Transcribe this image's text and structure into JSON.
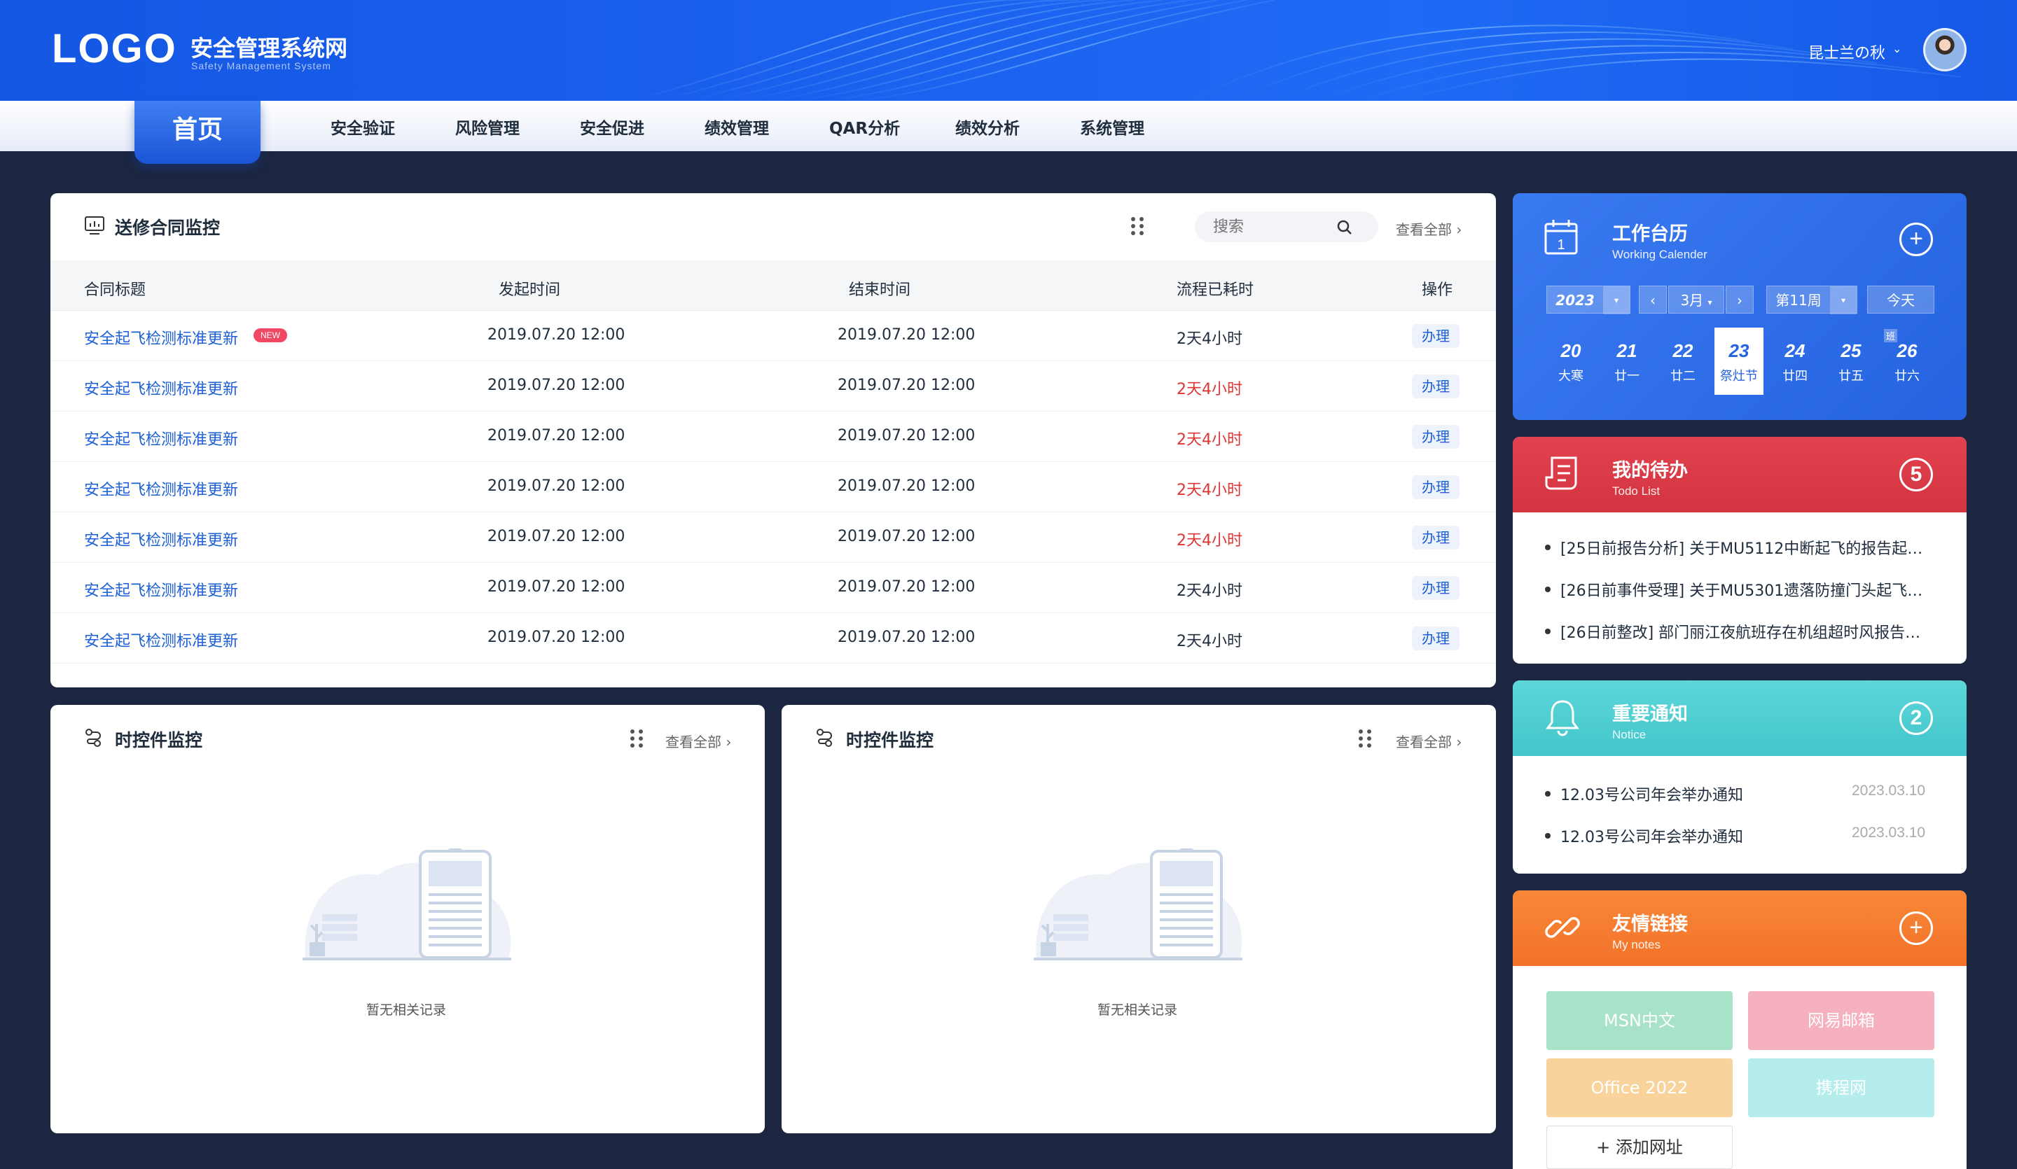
{
  "header": {
    "logo": "LOGO",
    "title": "安全管理系统网",
    "subtitle": "Safety Management System",
    "user_name": "昆士兰の秋",
    "user_caret": "⌄"
  },
  "nav": {
    "home": "首页",
    "items": [
      "安全验证",
      "风险管理",
      "安全促进",
      "绩效管理",
      "QAR分析",
      "绩效分析",
      "系统管理"
    ]
  },
  "contract": {
    "title": "送修合同监控",
    "search_placeholder": "搜索",
    "view_all": "查看全部",
    "columns": [
      "合同标题",
      "发起时间",
      "结束时间",
      "流程已耗时",
      "操作"
    ],
    "new_badge": "NEW",
    "rows": [
      {
        "title": "安全起飞检测标准更新",
        "start": "2019.07.20 12:00",
        "end": "2019.07.20 12:00",
        "elapsed": "2天4小时",
        "overdue": false,
        "action": "办理"
      },
      {
        "title": "安全起飞检测标准更新",
        "start": "2019.07.20 12:00",
        "end": "2019.07.20 12:00",
        "elapsed": "2天4小时",
        "overdue": true,
        "action": "办理"
      },
      {
        "title": "安全起飞检测标准更新",
        "start": "2019.07.20 12:00",
        "end": "2019.07.20 12:00",
        "elapsed": "2天4小时",
        "overdue": true,
        "action": "办理"
      },
      {
        "title": "安全起飞检测标准更新",
        "start": "2019.07.20 12:00",
        "end": "2019.07.20 12:00",
        "elapsed": "2天4小时",
        "overdue": true,
        "action": "办理"
      },
      {
        "title": "安全起飞检测标准更新",
        "start": "2019.07.20 12:00",
        "end": "2019.07.20 12:00",
        "elapsed": "2天4小时",
        "overdue": true,
        "action": "办理"
      },
      {
        "title": "安全起飞检测标准更新",
        "start": "2019.07.20 12:00",
        "end": "2019.07.20 12:00",
        "elapsed": "2天4小时",
        "overdue": false,
        "action": "办理"
      },
      {
        "title": "安全起飞检测标准更新",
        "start": "2019.07.20 12:00",
        "end": "2019.07.20 12:00",
        "elapsed": "2天4小时",
        "overdue": false,
        "action": "办理"
      }
    ]
  },
  "timer_left": {
    "title": "时控件监控",
    "view_all": "查看全部",
    "empty": "暂无相关记录"
  },
  "timer_right": {
    "title": "时控件监控",
    "view_all": "查看全部",
    "empty": "暂无相关记录"
  },
  "calendar": {
    "title": "工作台历",
    "subtitle": "Working Calender",
    "year": "2023",
    "month": "3月",
    "week": "第11周",
    "today_btn": "今天",
    "calendar_icon_day": "1",
    "extra_badge": "班",
    "days": [
      {
        "n": "20",
        "l": "大寒"
      },
      {
        "n": "21",
        "l": "廿一"
      },
      {
        "n": "22",
        "l": "廿二"
      },
      {
        "n": "23",
        "l": "祭灶节"
      },
      {
        "n": "24",
        "l": "廿四"
      },
      {
        "n": "25",
        "l": "廿五"
      },
      {
        "n": "26",
        "l": "廿六"
      }
    ]
  },
  "todo": {
    "title": "我的待办",
    "subtitle": "Todo List",
    "count": "5",
    "items": [
      "[25日前报告分析] 关于MU5112中断起飞的报告起…",
      "[26日前事件受理] 关于MU5301遗落防撞门头起飞…",
      "[26日前整改] 部门丽江夜航班存在机组超时风报告…"
    ]
  },
  "notice": {
    "title": "重要通知",
    "subtitle": "Notice",
    "count": "2",
    "items": [
      {
        "text": "12.03号公司年会举办通知",
        "date": "2023.03.10"
      },
      {
        "text": "12.03号公司年会举办通知",
        "date": "2023.03.10"
      }
    ]
  },
  "links": {
    "title": "友情链接",
    "subtitle": "My notes",
    "tiles": [
      "MSN中文",
      "网易邮箱",
      "Office 2022",
      "携程网"
    ],
    "add": "添加网址"
  },
  "colors": {
    "primary": "#1d5fd6",
    "calendar": "#2f6fe6",
    "todo": "#dd3b47",
    "notice": "#4fd0d4",
    "links": "#f57b2a",
    "danger": "#e03434"
  }
}
